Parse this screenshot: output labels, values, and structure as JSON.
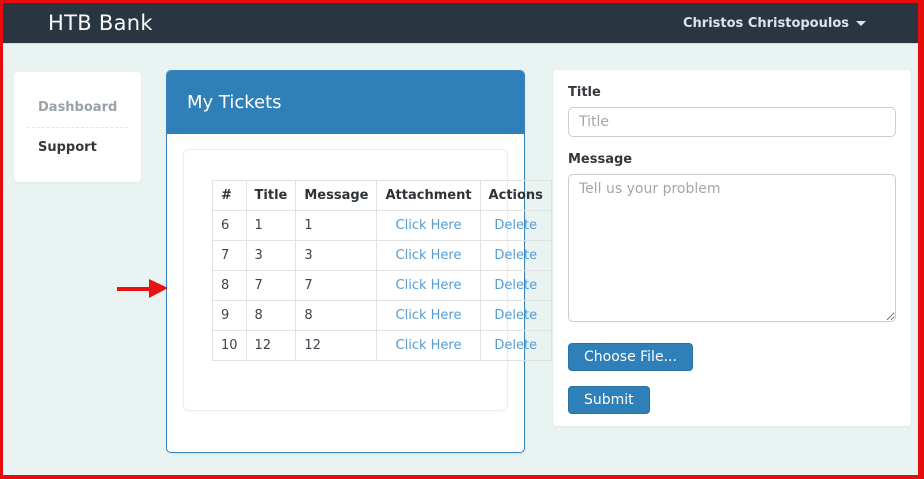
{
  "colors": {
    "navbar_bg": "#293642",
    "page_bg": "#e9f4f2",
    "primary_blue": "#2f7fb8",
    "link_blue": "#549cd4",
    "annotation_red": "#e81414"
  },
  "navbar": {
    "brand": "HTB Bank",
    "user_menu": {
      "name": "Christos Christopoulos"
    }
  },
  "sidebar": {
    "items": [
      {
        "label": "Dashboard"
      },
      {
        "label": "Support"
      }
    ]
  },
  "tickets_panel": {
    "title": "My Tickets",
    "table": {
      "headers": [
        "#",
        "Title",
        "Message",
        "Attachment",
        "Actions"
      ],
      "rows": [
        {
          "id": "6",
          "title": "1",
          "message": "1",
          "attachment_link": "Click Here",
          "action_link": "Delete"
        },
        {
          "id": "7",
          "title": "3",
          "message": "3",
          "attachment_link": "Click Here",
          "action_link": "Delete"
        },
        {
          "id": "8",
          "title": "7",
          "message": "7",
          "attachment_link": "Click Here",
          "action_link": "Delete"
        },
        {
          "id": "9",
          "title": "8",
          "message": "8",
          "attachment_link": "Click Here",
          "action_link": "Delete"
        },
        {
          "id": "10",
          "title": "12",
          "message": "12",
          "attachment_link": "Click Here",
          "action_link": "Delete"
        }
      ]
    }
  },
  "ticket_form": {
    "title_label": "Title",
    "title_placeholder": "Title",
    "message_label": "Message",
    "message_placeholder": "Tell us your problem",
    "choose_file_button": "Choose File...",
    "submit_button": "Submit"
  }
}
